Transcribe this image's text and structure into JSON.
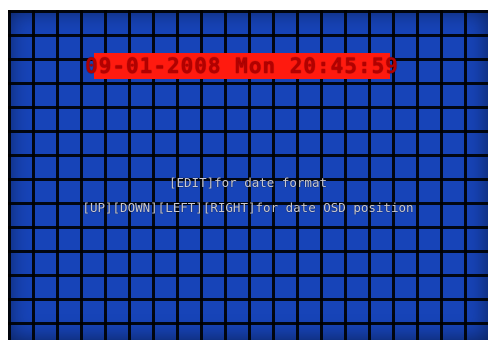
{
  "osd": {
    "datetime": "09-01-2008 Mon 20:45:59",
    "hint_edit": "[EDIT]for date format",
    "hint_position": "[UP][DOWN][LEFT][RIGHT]for date OSD position"
  },
  "colors": {
    "grid_blue": "#1744b8",
    "grid_lines": "#000000",
    "date_bar_bg": "#ff1a0f",
    "date_text": "#b30000",
    "hint_text": "#c9c9d2"
  }
}
